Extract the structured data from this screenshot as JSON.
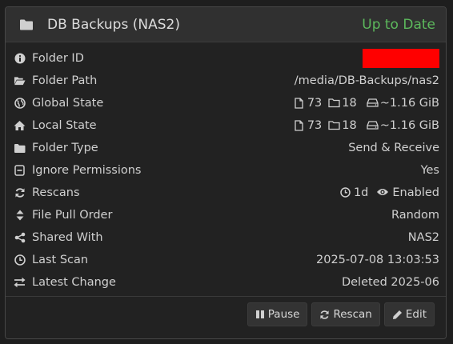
{
  "header": {
    "title": "DB Backups (NAS2)",
    "status": "Up to Date",
    "status_color": "#5cb85c"
  },
  "rows": {
    "folder_id": {
      "label": "Folder ID",
      "icon": "info-icon",
      "value_redacted": true
    },
    "folder_path": {
      "label": "Folder Path",
      "icon": "folder-open-icon",
      "value": "/media/DB-Backups/nas2"
    },
    "global_state": {
      "label": "Global State",
      "icon": "globe-icon",
      "files": "73",
      "dirs": "18",
      "size": "~1.16 GiB"
    },
    "local_state": {
      "label": "Local State",
      "icon": "home-icon",
      "files": "73",
      "dirs": "18",
      "size": "~1.16 GiB"
    },
    "folder_type": {
      "label": "Folder Type",
      "icon": "folder-icon",
      "value": "Send & Receive"
    },
    "ignore_permissions": {
      "label": "Ignore Permissions",
      "icon": "square-minus-icon",
      "value": "Yes"
    },
    "rescans": {
      "label": "Rescans",
      "icon": "refresh-icon",
      "interval": "1d",
      "watcher": "Enabled"
    },
    "file_pull_order": {
      "label": "File Pull Order",
      "icon": "sort-icon",
      "value": "Random"
    },
    "shared_with": {
      "label": "Shared With",
      "icon": "share-icon",
      "value": "NAS2",
      "link_color": "#4a9de0"
    },
    "last_scan": {
      "label": "Last Scan",
      "icon": "clock-icon",
      "value": "2025-07-08 13:03:53"
    },
    "latest_change": {
      "label": "Latest Change",
      "icon": "exchange-icon",
      "value": "Deleted 2025-06"
    }
  },
  "buttons": {
    "pause": "Pause",
    "rescan": "Rescan",
    "edit": "Edit"
  }
}
